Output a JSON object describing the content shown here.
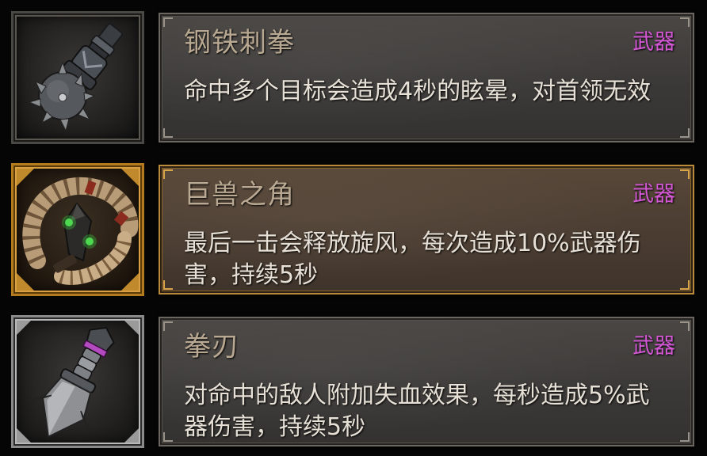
{
  "items": [
    {
      "name": "钢铁刺拳",
      "tag": "武器",
      "description": "命中多个目标会造成4秒的眩晕，对首领无效",
      "icon": "spiked-mace-icon",
      "rarity_color": "#6b6660"
    },
    {
      "name": "巨兽之角",
      "tag": "武器",
      "description": "最后一击会释放旋风，每次造成10%武器伤害，持续5秒",
      "icon": "beast-horn-icon",
      "rarity_color": "#b98a3a"
    },
    {
      "name": "拳刃",
      "tag": "武器",
      "description": "对命中的敌人附加失血效果，每秒造成5%武器伤害，持续5秒",
      "icon": "fist-blade-icon",
      "rarity_color": "#8a8a8a"
    }
  ],
  "tag_color": "#d457d6"
}
